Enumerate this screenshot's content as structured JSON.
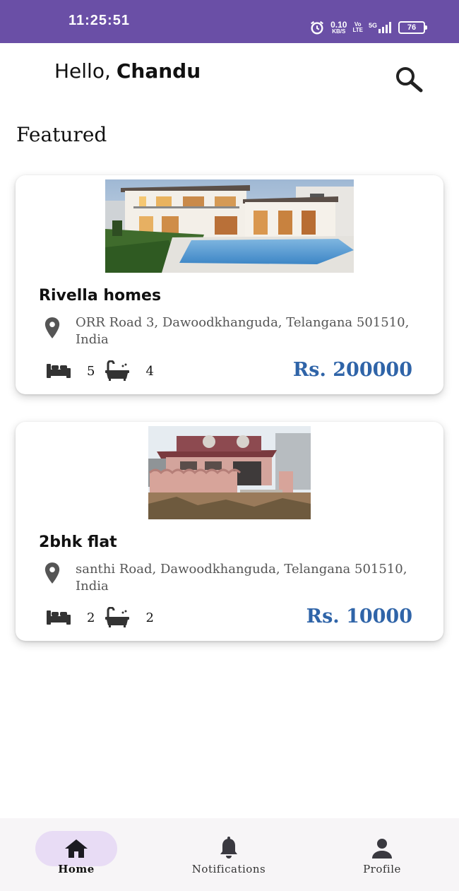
{
  "status_bar": {
    "time": "11:25:51",
    "net_speed_value": "0.10",
    "net_speed_unit": "KB/S",
    "volte_top": "Vo",
    "volte_bottom": "LTE",
    "network": "5G",
    "battery": "76",
    "color": "#6a4fa6"
  },
  "header": {
    "greeting": "Hello,",
    "user_name": "Chandu",
    "search_icon": "search-icon"
  },
  "section": {
    "title": "Featured"
  },
  "listings": [
    {
      "title": "Rivella homes",
      "address": "ORR Road 3, Dawoodkhanguda, Telangana 501510, India",
      "bedrooms": "5",
      "bathrooms": "4",
      "price": "Rs. 200000",
      "image": "villa-with-pool"
    },
    {
      "title": "2bhk flat",
      "address": "santhi Road, Dawoodkhanguda, Telangana 501510, India",
      "bedrooms": "2",
      "bathrooms": "2",
      "price": "Rs. 10000",
      "image": "single-storey-house"
    }
  ],
  "bottom_nav": {
    "items": [
      {
        "label": "Home",
        "icon": "home-icon",
        "active": true
      },
      {
        "label": "Notifications",
        "icon": "bell-icon",
        "active": false
      },
      {
        "label": "Profile",
        "icon": "person-icon",
        "active": false
      }
    ],
    "active_color": "#e8dcf5"
  },
  "colors": {
    "price": "#2f64a8",
    "accent": "#6a4fa6"
  }
}
